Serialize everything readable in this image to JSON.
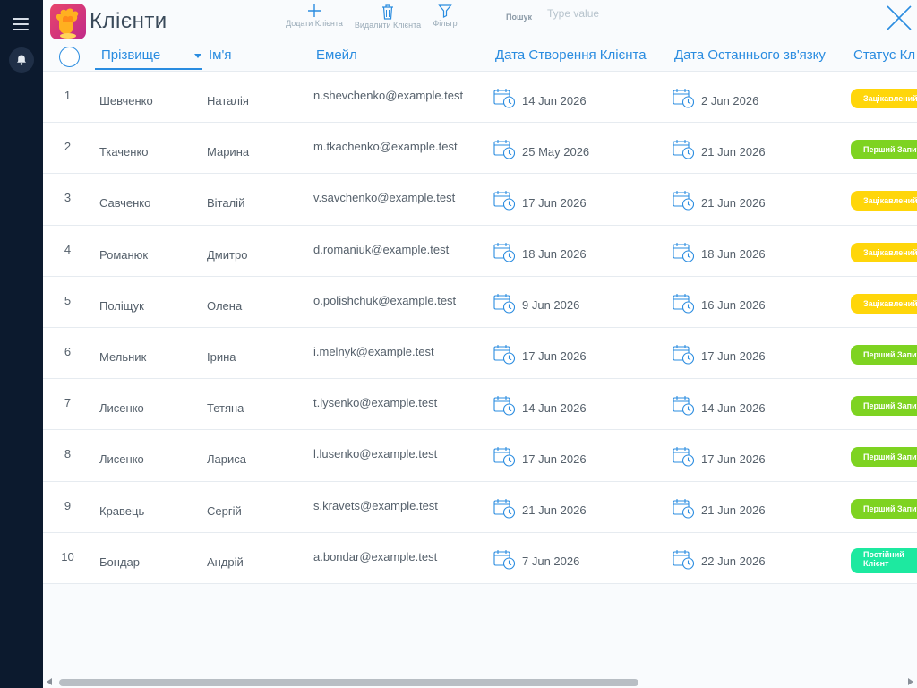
{
  "app": {
    "title": "Клієнти",
    "logo_icon": "app-logo-icon"
  },
  "toolbar": {
    "add_label": "Додати Клієнта",
    "delete_label": "Видалити Клієнта",
    "filter_label": "Фільтр",
    "search_label": "Пошук",
    "search_placeholder": "Type value",
    "search_value": ""
  },
  "columns": {
    "last_name": "Прізвище",
    "first_name": "Ім'я",
    "email": "Емейл",
    "created": "Дата Створення Клієнта",
    "last_contact": "Дата Останнього зв'язку",
    "status": "Статус Кл"
  },
  "status_colors": {
    "interested": "#ffd60a",
    "first_request": "#7ed321",
    "regular": "#1de9a0"
  },
  "rows": [
    {
      "num": "1",
      "last": "Шевченко",
      "first": "Наталія",
      "email": "n.shevchenko@example.test",
      "created": "14 Jun 2026",
      "contact": "2 Jun 2026",
      "status": "Зацікавлений",
      "status_type": "interested"
    },
    {
      "num": "2",
      "last": "Ткаченко",
      "first": "Марина",
      "email": "m.tkachenko@example.test",
      "created": "25 May 2026",
      "contact": "21 Jun 2026",
      "status": "Перший Запит",
      "status_type": "first_request"
    },
    {
      "num": "3",
      "last": "Савченко",
      "first": "Віталій",
      "email": "v.savchenko@example.test",
      "created": "17 Jun 2026",
      "contact": "21 Jun 2026",
      "status": "Зацікавлений",
      "status_type": "interested"
    },
    {
      "num": "4",
      "last": "Романюк",
      "first": "Дмитро",
      "email": "d.romaniuk@example.test",
      "created": "18 Jun 2026",
      "contact": "18 Jun 2026",
      "status": "Зацікавлений",
      "status_type": "interested"
    },
    {
      "num": "5",
      "last": "Поліщук",
      "first": "Олена",
      "email": "o.polishchuk@example.test",
      "created": "9 Jun 2026",
      "contact": "16 Jun 2026",
      "status": "Зацікавлений",
      "status_type": "interested"
    },
    {
      "num": "6",
      "last": "Мельник",
      "first": "Ірина",
      "email": "i.melnyk@example.test",
      "created": "17 Jun 2026",
      "contact": "17 Jun 2026",
      "status": "Перший Запит",
      "status_type": "first_request"
    },
    {
      "num": "7",
      "last": "Лисенко",
      "first": "Тетяна",
      "email": "t.lysenko@example.test",
      "created": "14 Jun 2026",
      "contact": "14 Jun 2026",
      "status": "Перший Запит",
      "status_type": "first_request"
    },
    {
      "num": "8",
      "last": "Лисенко",
      "first": "Лариса",
      "email": "l.lusenko@example.test",
      "created": "17 Jun 2026",
      "contact": "17 Jun 2026",
      "status": "Перший Запит",
      "status_type": "first_request"
    },
    {
      "num": "9",
      "last": "Кравець",
      "first": "Сергій",
      "email": "s.kravets@example.test",
      "created": "21 Jun 2026",
      "contact": "21 Jun 2026",
      "status": "Перший Запит",
      "status_type": "first_request"
    },
    {
      "num": "10",
      "last": "Бондар",
      "first": "Андрій",
      "email": "a.bondar@example.test",
      "created": "7 Jun 2026",
      "contact": "22 Jun 2026",
      "status": "Постійний Клієнт",
      "status_type": "regular"
    }
  ]
}
